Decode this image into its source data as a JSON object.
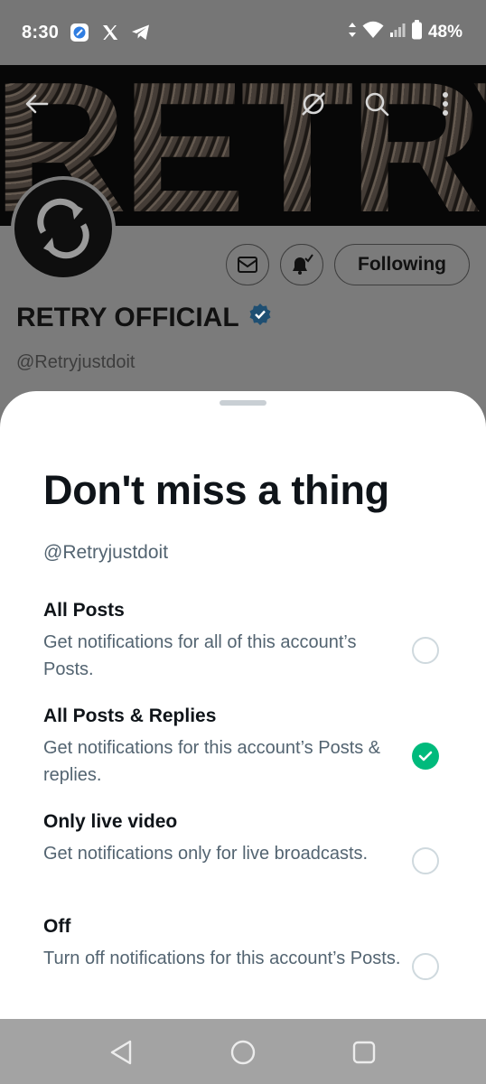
{
  "status_bar": {
    "time": "8:30",
    "battery": "48%",
    "icons": [
      "browser-app-icon",
      "x-app-icon",
      "telegram-icon",
      "data-arrows-icon",
      "wifi-icon",
      "signal-icon",
      "battery-icon"
    ]
  },
  "profile": {
    "banner_text": "RETRY",
    "name": "RETRY OFFICIAL",
    "handle": "@Retryjustdoit",
    "following_label": "Following"
  },
  "sheet": {
    "title": "Don't miss a thing",
    "handle": "@Retryjustdoit",
    "options": [
      {
        "title": "All Posts",
        "desc": "Get notifications for all of this account’s Posts.",
        "selected": false
      },
      {
        "title": "All Posts & Replies",
        "desc": "Get notifications for this account’s Posts & replies.",
        "selected": true
      },
      {
        "title": "Only live video",
        "desc": "Get notifications only for live broadcasts.",
        "selected": false
      },
      {
        "title": "Off",
        "desc": "Turn off notifications for this account’s Posts.",
        "selected": false
      }
    ]
  },
  "colors": {
    "accent_green": "#00ba7c",
    "verified_blue": "#1d9bf0",
    "text_primary": "#0f1419",
    "text_secondary": "#536471"
  }
}
